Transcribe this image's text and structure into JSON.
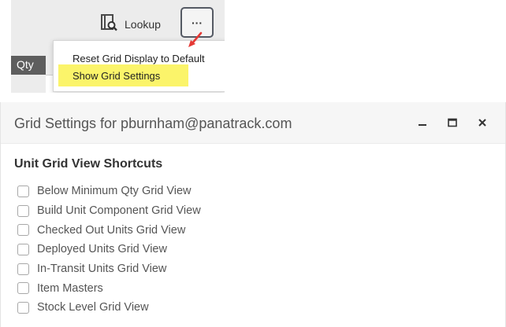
{
  "toolbar": {
    "lookup_label": "Lookup",
    "more_label": "···",
    "icons": {
      "lookup": "lookup-book-magnifier-icon",
      "more": "ellipsis-icon"
    }
  },
  "grid": {
    "qty_header": "Qty"
  },
  "menu": {
    "items": [
      {
        "label": "Reset Grid Display to Default"
      },
      {
        "label": "Show Grid Settings",
        "highlighted": true
      }
    ],
    "highlight_color": "#fbf46a",
    "annotation_arrow_color": "#e53935"
  },
  "dialog": {
    "title": "Grid Settings for pburnham@panatrack.com",
    "icons": {
      "minimize": "minimize-icon",
      "maximize": "maximize-icon",
      "close": "close-icon"
    },
    "section_title": "Unit Grid View Shortcuts",
    "shortcuts": [
      {
        "label": "Below Minimum Qty Grid View",
        "checked": false
      },
      {
        "label": "Build Unit Component Grid View",
        "checked": false
      },
      {
        "label": "Checked Out Units Grid View",
        "checked": false
      },
      {
        "label": "Deployed Units Grid View",
        "checked": false
      },
      {
        "label": "In-Transit Units Grid View",
        "checked": false
      },
      {
        "label": "Item Masters",
        "checked": false
      },
      {
        "label": "Stock Level Grid View",
        "checked": false
      }
    ]
  }
}
